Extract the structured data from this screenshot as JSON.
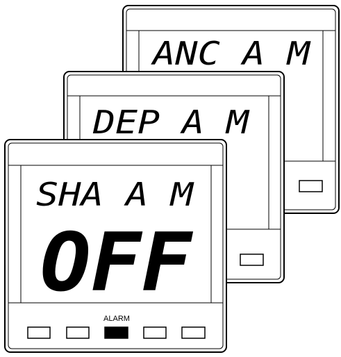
{
  "displays": [
    {
      "id": "anc",
      "top_text": "ANC A M",
      "button_count": 1
    },
    {
      "id": "dep",
      "top_text": "DEP A M",
      "button_count": 1
    },
    {
      "id": "sha",
      "top_text": "SHA A M",
      "main_text": "OFF",
      "button_label": "ALARM",
      "buttons": [
        "",
        "",
        "alarm",
        "",
        ""
      ],
      "active_button": "alarm"
    }
  ],
  "colors": {
    "frame": "#000000",
    "background": "#ffffff",
    "active_button": "#000000"
  }
}
